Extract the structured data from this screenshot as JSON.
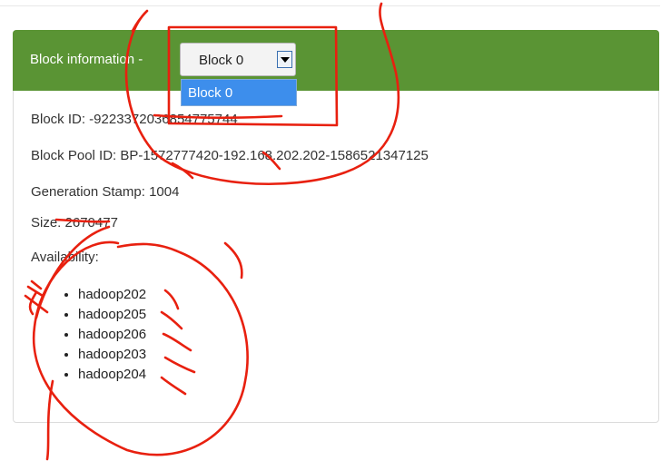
{
  "panel": {
    "heading_label": "Block information -",
    "select": {
      "selected_value": "Block 0",
      "options": [
        "Block 0"
      ],
      "highlighted_option": "Block 0"
    }
  },
  "block": {
    "id_line": "Block ID: -9223372036854775744",
    "pool_line": "Block Pool ID: BP-1572777420-192.168.202.202-1586521347125",
    "generation_line": "Generation Stamp: 1004",
    "size_line": "Size: 2670477",
    "availability_label": "Availability:"
  },
  "availability_nodes": [
    "hadoop202",
    "hadoop205",
    "hadoop206",
    "hadoop203",
    "hadoop204"
  ],
  "colors": {
    "heading_bg": "#5a9434",
    "dropdown_highlight": "#3d8eec",
    "annotation_stroke": "#e8200f"
  }
}
